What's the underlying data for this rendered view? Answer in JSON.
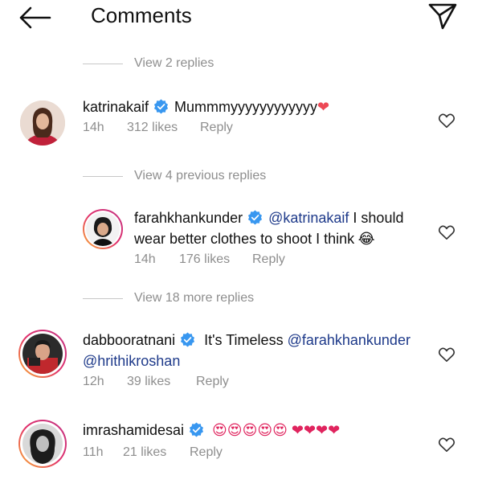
{
  "header": {
    "title": "Comments"
  },
  "view_links": {
    "first": "View 2 replies",
    "second": "View 4 previous replies",
    "third": "View 18 more replies"
  },
  "comments": [
    {
      "username": "katrinakaif",
      "text": "Mummmyyyyyyyyyyyy",
      "emoji": "❤",
      "time": "14h",
      "likes": "312 likes",
      "reply": "Reply"
    },
    {
      "username": "farahkhankunder",
      "mention": "@katrinakaif",
      "text": " I should",
      "text2": "wear better clothes to shoot I think",
      "emoji": "😂",
      "time": "14h",
      "likes": "176 likes",
      "reply": "Reply"
    },
    {
      "username": "dabbooratnani",
      "text": "It's Timeless ",
      "mention": "@farahkhankunder",
      "mention2": "@hrithikroshan",
      "time": "12h",
      "likes": "39 likes",
      "reply": "Reply"
    },
    {
      "username": "imrashamidesai",
      "emojis": "😍😍😍😍😍 ❤❤❤❤",
      "time": "11h",
      "likes": "21 likes",
      "reply": "Reply"
    }
  ],
  "colors": {
    "verified": "#3897f0",
    "muted": "#8e8e8e",
    "heart_red": "#ed4956"
  },
  "icons": [
    "back-arrow-icon",
    "send-icon",
    "verified-badge-icon",
    "heart-outline-icon"
  ]
}
